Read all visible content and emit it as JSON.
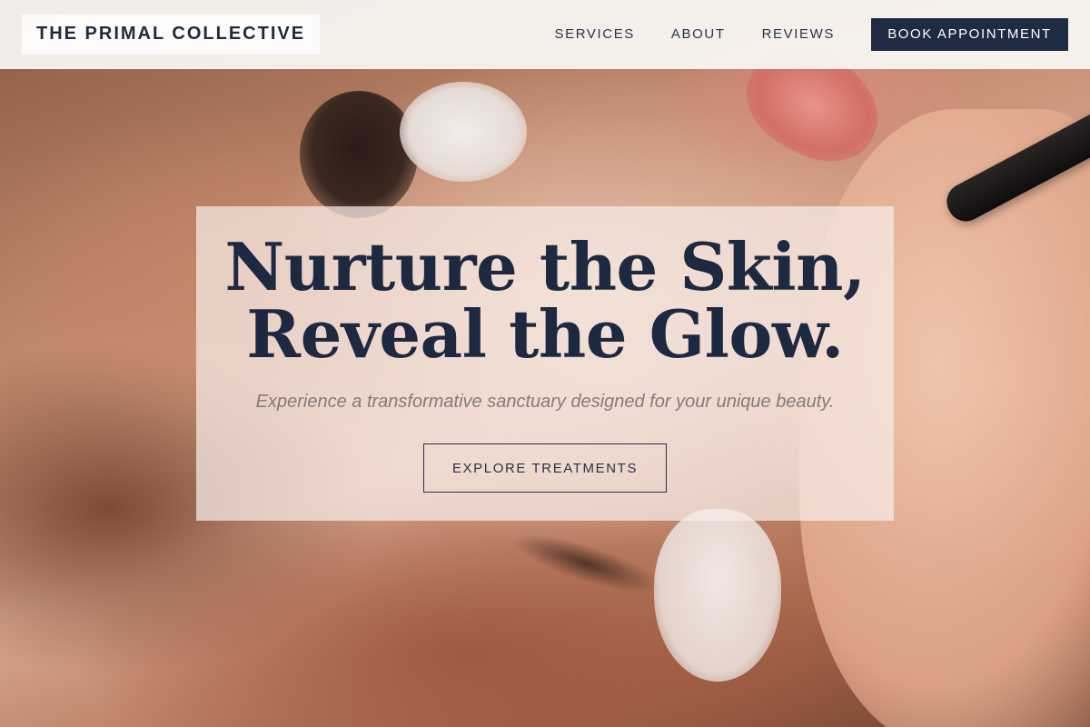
{
  "brand": {
    "name": "THE PRIMAL COLLECTIVE"
  },
  "nav": {
    "links": [
      {
        "label": "SERVICES"
      },
      {
        "label": "ABOUT"
      },
      {
        "label": "REVIEWS"
      }
    ],
    "cta_label": "BOOK APPOINTMENT"
  },
  "hero": {
    "headline_line1": "Nurture the Skin,",
    "headline_line2": "Reveal the Glow.",
    "subtext": "Experience a transformative sanctuary designed for your unique beauty.",
    "cta_label": "EXPLORE TREATMENTS",
    "background_image": "close-up-makeup-application-photo"
  },
  "colors": {
    "navy": "#1f2b42",
    "header_bg": "#faf7f4",
    "card_bg": "#f6ece8",
    "subtext": "#857b79"
  }
}
